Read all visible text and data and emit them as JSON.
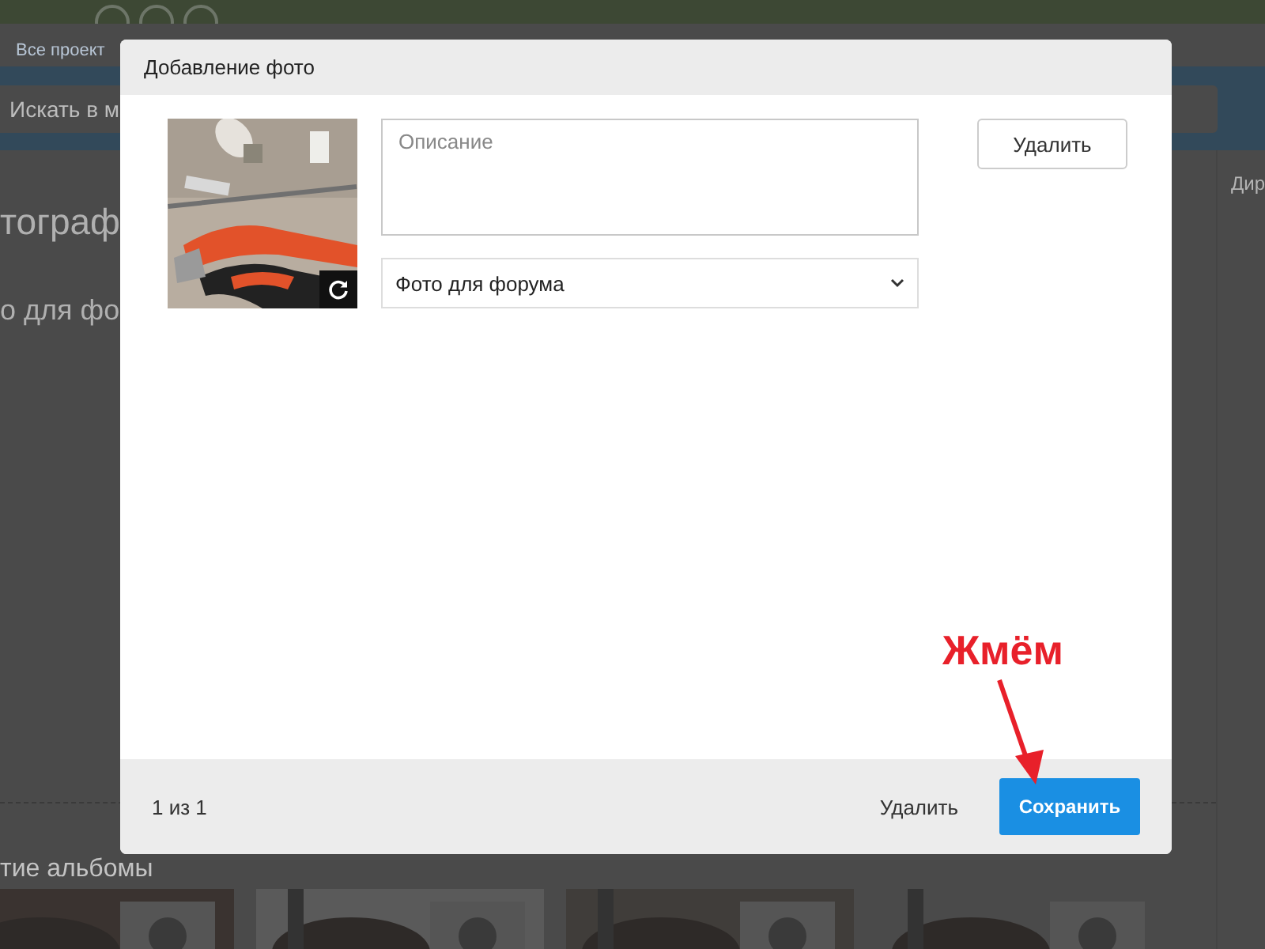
{
  "background_page": {
    "nav_link": "Все проект",
    "search": {
      "placeholder": "Искать в м"
    },
    "page_title": "тограф",
    "album_title": "о для фо",
    "right_label": "Дир",
    "section_title": "тие альбомы"
  },
  "dialog": {
    "title": "Добавление фото",
    "description": {
      "placeholder": "Описание"
    },
    "album_select": {
      "value": "Фото для форума"
    },
    "delete_button": "Удалить",
    "counter": "1 из 1",
    "footer_buttons": [
      {
        "label": "Удалить",
        "kind": "link"
      },
      {
        "label": "Сохранить",
        "kind": "primary"
      }
    ]
  },
  "annotation": {
    "text": "Жмём"
  }
}
